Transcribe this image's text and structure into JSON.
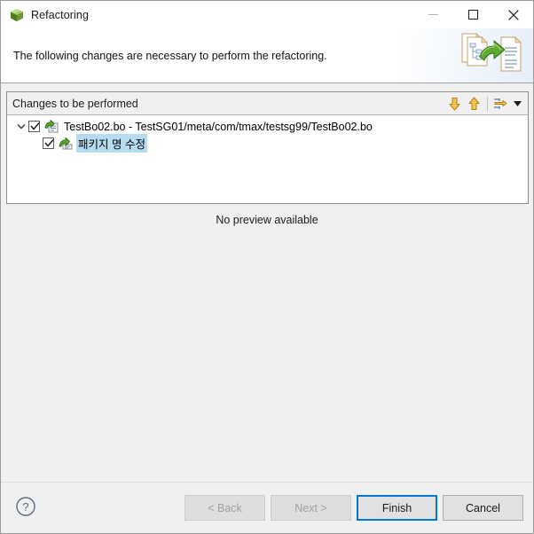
{
  "window": {
    "title": "Refactoring",
    "icon": "eclipse-cube-icon",
    "controls": {
      "minimize": {
        "name": "minimize-button",
        "glyph": "–"
      },
      "maximize": {
        "name": "maximize-button",
        "glyph": "□"
      },
      "close": {
        "name": "close-button",
        "glyph": "✕"
      }
    }
  },
  "banner": {
    "message": "The following changes are necessary to perform the refactoring.",
    "image": "refactoring-banner-icon"
  },
  "changes": {
    "header_label": "Changes to be performed",
    "tools": [
      {
        "name": "next-change-button",
        "icon": "down-arrow-icon",
        "color": "#e8a33d"
      },
      {
        "name": "previous-change-button",
        "icon": "up-arrow-icon",
        "color": "#e8a33d"
      },
      {
        "name": "view-menu-button",
        "icon": "filter-menu-icon"
      },
      {
        "name": "view-menu-chevron",
        "icon": "chevron-down-icon"
      }
    ],
    "tree": [
      {
        "level": 0,
        "expanded": true,
        "checked": true,
        "icon": "java-compilation-unit-change-icon",
        "label": "TestBo02.bo - TestSG01/meta/com/tmax/testsg99/TestBo02.bo",
        "selected": false
      },
      {
        "level": 1,
        "expanded": null,
        "checked": true,
        "icon": "package-rename-change-icon",
        "label": "패키지 명 수정",
        "selected": true
      }
    ]
  },
  "preview": {
    "message": "No preview available"
  },
  "footer": {
    "help": {
      "name": "help-button",
      "icon": "question-mark-icon"
    },
    "buttons": [
      {
        "name": "back-button",
        "label": "< Back",
        "state": "disabled"
      },
      {
        "name": "next-button",
        "label": "Next >",
        "state": "disabled"
      },
      {
        "name": "finish-button",
        "label": "Finish",
        "state": "default"
      },
      {
        "name": "cancel-button",
        "label": "Cancel",
        "state": "normal"
      }
    ]
  },
  "colors": {
    "accent": "#0078d7",
    "selection": "#b5dcf0",
    "arrow": "#e8a33d",
    "window_bg": "#f0f0f0"
  }
}
